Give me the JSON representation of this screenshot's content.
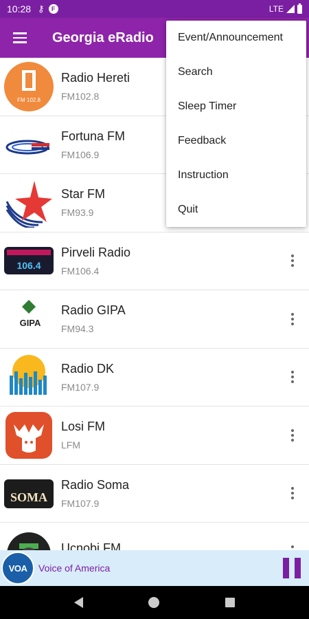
{
  "status_bar": {
    "time": "10:28",
    "network": "LTE",
    "icons": [
      "key-icon",
      "f-badge-icon",
      "signal-icon",
      "battery-icon"
    ]
  },
  "app_bar": {
    "title": "Georgia eRadio"
  },
  "menu": {
    "items": [
      {
        "label": "Event/Announcement"
      },
      {
        "label": "Search"
      },
      {
        "label": "Sleep Timer"
      },
      {
        "label": "Feedback"
      },
      {
        "label": "Instruction"
      },
      {
        "label": "Quit"
      }
    ]
  },
  "stations": [
    {
      "name": "Radio Hereti",
      "freq": "FM102.8",
      "logo_text": "FM 102.8"
    },
    {
      "name": "Fortuna FM",
      "freq": "FM106.9",
      "logo_text": ""
    },
    {
      "name": "Star FM",
      "freq": "FM93.9",
      "logo_text": ""
    },
    {
      "name": "Pirveli Radio",
      "freq": "FM106.4",
      "logo_text": "106.4"
    },
    {
      "name": "Radio GIPA",
      "freq": "FM94.3",
      "logo_text": "GIPA"
    },
    {
      "name": "Radio DK",
      "freq": "FM107.9",
      "logo_text": ""
    },
    {
      "name": "Losi FM",
      "freq": "LFM",
      "logo_text": ""
    },
    {
      "name": "Radio Soma",
      "freq": "FM107.9",
      "logo_text": "SOMA"
    },
    {
      "name": "Ucnobi FM",
      "freq": "",
      "logo_text": ""
    }
  ],
  "player": {
    "logo_text": "VOA",
    "station_name": "Voice of America"
  },
  "colors": {
    "primary": "#8E24AA",
    "status": "#7B1FA2",
    "player_bg": "#d8ecf9"
  }
}
